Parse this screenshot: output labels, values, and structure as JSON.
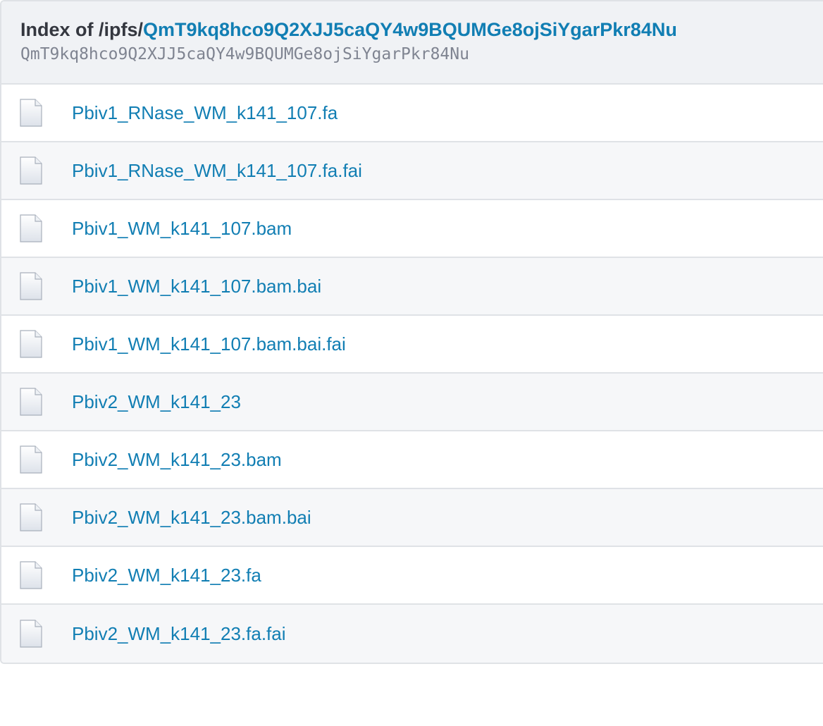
{
  "header": {
    "title_prefix": "Index of /ipfs/",
    "title_hash_link": "QmT9kq8hco9Q2XJJ5caQY4w9BQUMGe8ojSiYgarPkr84Nu",
    "hash": "QmT9kq8hco9Q2XJJ5caQY4w9BQUMGe8ojSiYgarPkr84Nu"
  },
  "files": [
    {
      "name": "Pbiv1_RNase_WM_k141_107.fa",
      "icon": "file-icon"
    },
    {
      "name": "Pbiv1_RNase_WM_k141_107.fa.fai",
      "icon": "file-icon"
    },
    {
      "name": "Pbiv1_WM_k141_107.bam",
      "icon": "file-icon"
    },
    {
      "name": "Pbiv1_WM_k141_107.bam.bai",
      "icon": "file-icon"
    },
    {
      "name": "Pbiv1_WM_k141_107.bam.bai.fai",
      "icon": "file-icon"
    },
    {
      "name": "Pbiv2_WM_k141_23",
      "icon": "file-icon"
    },
    {
      "name": "Pbiv2_WM_k141_23.bam",
      "icon": "file-icon"
    },
    {
      "name": "Pbiv2_WM_k141_23.bam.bai",
      "icon": "file-icon"
    },
    {
      "name": "Pbiv2_WM_k141_23.fa",
      "icon": "file-icon"
    },
    {
      "name": "Pbiv2_WM_k141_23.fa.fai",
      "icon": "file-icon"
    }
  ],
  "colors": {
    "link": "#117eb3",
    "header_bg": "#f0f2f5",
    "title_text": "#34373f",
    "hash_text": "#7f8491",
    "border": "#dfe2e6",
    "row_alt_bg": "#f6f7f9"
  }
}
